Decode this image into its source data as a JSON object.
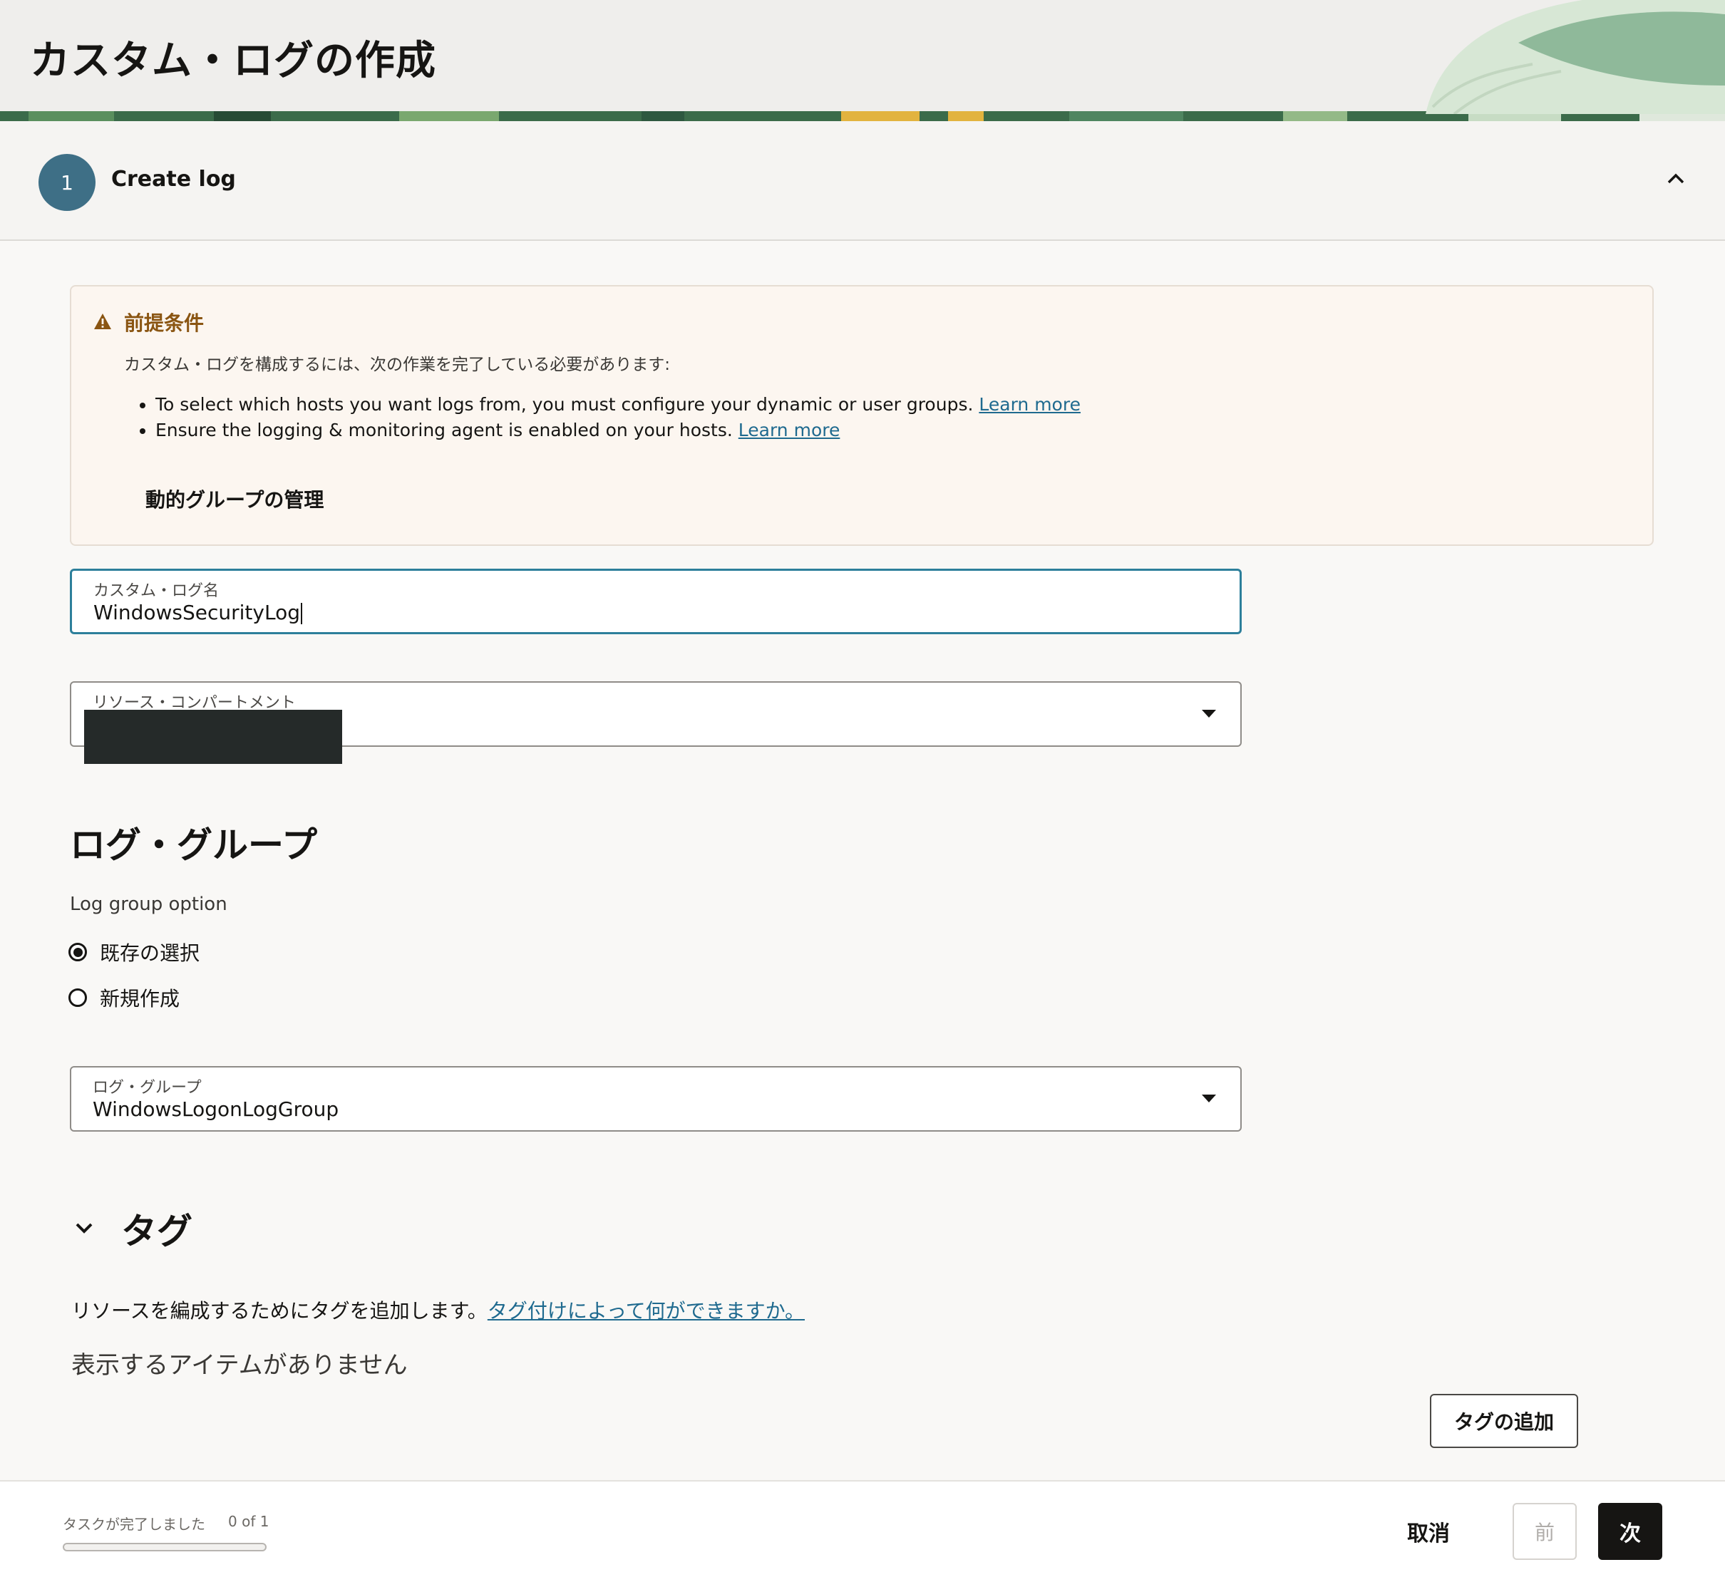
{
  "page": {
    "title": "カスタム・ログの作成"
  },
  "step": {
    "number": "1",
    "label": "Create log"
  },
  "prerequisites": {
    "title": "前提条件",
    "intro": "カスタム・ログを構成するには、次の作業を完了している必要があります:",
    "items": [
      {
        "text": "To select which hosts you want logs from, you must configure your dynamic or user groups.",
        "link": "Learn more"
      },
      {
        "text": "Ensure the logging & monitoring agent is enabled on your hosts.",
        "link": "Learn more"
      }
    ],
    "manage_link": "動的グループの管理"
  },
  "custom_log_name": {
    "label": "カスタム・ログ名",
    "value": "WindowsSecurityLog"
  },
  "resource_compartment": {
    "label": "リソース・コンパートメント"
  },
  "log_group_section": {
    "heading": "ログ・グループ",
    "option_label": "Log group option",
    "options": [
      {
        "label": "既存の選択",
        "selected": true
      },
      {
        "label": "新規作成",
        "selected": false
      }
    ],
    "field_label": "ログ・グループ",
    "field_value": "WindowsLogonLogGroup"
  },
  "tags": {
    "heading": "タグ",
    "description": "リソースを編成するためにタグを追加します。",
    "help_link": "タグ付けによって何ができますか。",
    "empty_message": "表示するアイテムがありません",
    "add_button": "タグの追加"
  },
  "footer": {
    "tasks_label": "タスクが完了しました",
    "tasks_count": "0 of 1",
    "progress": 0,
    "cancel": "取消",
    "previous": "前",
    "next": "次"
  },
  "colors": {
    "accent": "#2d7f9b",
    "link": "#1f6a8f",
    "warning": "#8a5512",
    "primary_button": "#161513"
  }
}
